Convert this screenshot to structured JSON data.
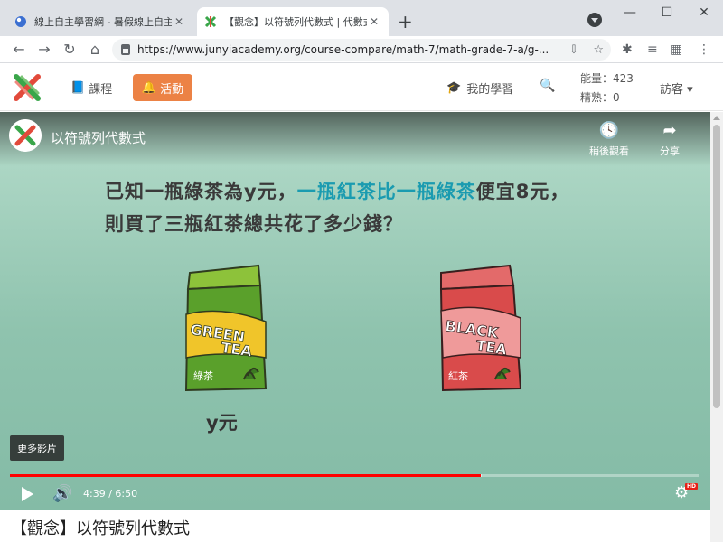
{
  "browser": {
    "tabs": [
      {
        "title": "線上自主學習網 - 暑假線上自主學"
      },
      {
        "title": "【觀念】以符號列代數式 | 代數式"
      }
    ],
    "url": "https://www.junyiacademy.org/course-compare/math-7/math-grade-7-a/g-..."
  },
  "site_nav": {
    "course_label": "課程",
    "activity_label": "活動",
    "my_learning_label": "我的學習",
    "energy": "能量：423",
    "mastery": "精熟：0",
    "visitor_label": "訪客"
  },
  "video": {
    "title": "以符號列代數式",
    "watch_later_label": "稍後觀看",
    "share_label": "分享",
    "question_line1_a": "已知一瓶綠茶為y元，",
    "question_line1_highlight": "一瓶紅茶比一瓶綠茶",
    "question_line1_b": "便宜8元，",
    "question_line2": "則買了三瓶紅茶總共花了多少錢？",
    "green_pkg_line1": "GREEN",
    "green_pkg_line2": "TEA",
    "green_pkg_cn": "綠茶",
    "black_pkg_line1": "BLACK",
    "black_pkg_line2": "TEA",
    "black_pkg_cn": "紅茶",
    "price_label": "y元",
    "more_videos_label": "更多影片",
    "time_display": "4:39 / 6:50",
    "progress_played": 0.684,
    "progress_buffered": 0.685,
    "hd_badge": "HD"
  },
  "page_title": "【觀念】以符號列代數式",
  "colors": {
    "accent_orange": "#ec8245",
    "highlight_teal": "#1a9bb0",
    "progress_red": "#ff0000"
  }
}
